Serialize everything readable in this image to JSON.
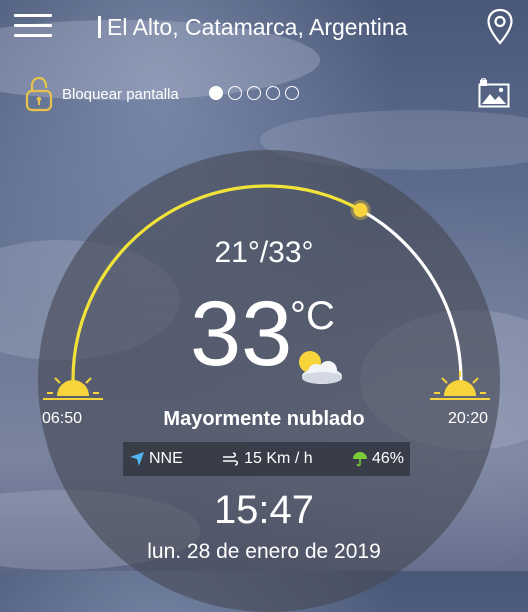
{
  "header": {
    "location": "El Alto, Catamarca, Argentina",
    "menu_icon": "hamburger-menu-icon",
    "location_icon": "map-pin-icon"
  },
  "toolbar": {
    "lock_label": "Bloquear pantalla",
    "lock_icon": "padlock-icon",
    "page_dots": 5,
    "active_page": 1,
    "wallpaper_icon": "image-lock-icon"
  },
  "weather": {
    "range": "21°/33°",
    "temperature": "33",
    "unit": "°C",
    "condition": "Mayormente nublado",
    "condition_icon": "partly-cloudy-icon",
    "sunrise": "06:50",
    "sunset": "20:20",
    "sun_progress": 0.66,
    "wind": "NNE",
    "wind_speed": "15 Km / h",
    "rain_chance": "46%",
    "time": "15:47",
    "date": "lun. 28 de enero de 2019"
  },
  "colors": {
    "arc_elapsed": "#f2e33a",
    "arc_remaining": "#ffffff",
    "sun": "#f7d43c",
    "rain_icon": "#7ccc3a",
    "lock_icon": "#e8c24a"
  }
}
